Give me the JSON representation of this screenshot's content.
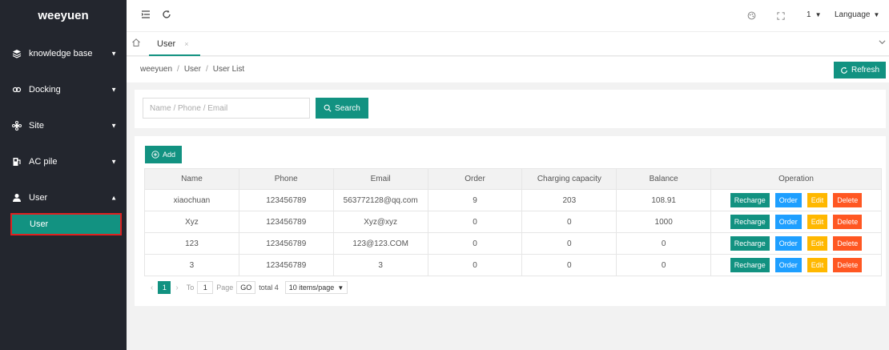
{
  "sidebar": {
    "logo": "weeyuen",
    "items": [
      {
        "label": "knowledge base",
        "icon": "layers-icon"
      },
      {
        "label": "Docking",
        "icon": "docking-icon"
      },
      {
        "label": "Site",
        "icon": "site-icon"
      },
      {
        "label": "AC pile",
        "icon": "ac-pile-icon"
      },
      {
        "label": "User",
        "icon": "user-icon"
      }
    ],
    "sub_item": "User"
  },
  "header": {
    "user_menu": "1",
    "language": "Language"
  },
  "tabs": {
    "active": "User",
    "close": "×"
  },
  "breadcrumb": [
    "weeyuen",
    "User",
    "User List"
  ],
  "refresh_label": "Refresh",
  "search": {
    "placeholder": "Name / Phone / Email",
    "button": "Search"
  },
  "add_label": "Add",
  "table": {
    "columns": [
      "Name",
      "Phone",
      "Email",
      "Order",
      "Charging capacity",
      "Balance",
      "Operation"
    ],
    "rows": [
      {
        "name": "xiaochuan",
        "phone": "123456789",
        "email": "563772128@qq.com",
        "order": "9",
        "capacity": "203",
        "balance": "108.91"
      },
      {
        "name": "Xyz",
        "phone": "123456789",
        "email": "Xyz@xyz",
        "order": "0",
        "capacity": "0",
        "balance": "1000"
      },
      {
        "name": "123",
        "phone": "123456789",
        "email": "123@123.COM",
        "order": "0",
        "capacity": "0",
        "balance": "0"
      },
      {
        "name": "3",
        "phone": "123456789",
        "email": "3",
        "order": "0",
        "capacity": "0",
        "balance": "0"
      }
    ],
    "ops": {
      "recharge": "Recharge",
      "order": "Order",
      "edit": "Edit",
      "delete": "Delete"
    }
  },
  "pagination": {
    "current": "1",
    "to": "To",
    "page_input": "1",
    "page": "Page",
    "go": "GO",
    "total": "total 4",
    "per_page": "10 items/page"
  },
  "colors": {
    "accent": "#129281",
    "sidebar_bg": "#23262e",
    "order": "#1e9fff",
    "edit": "#ffb800",
    "delete": "#ff5722"
  }
}
